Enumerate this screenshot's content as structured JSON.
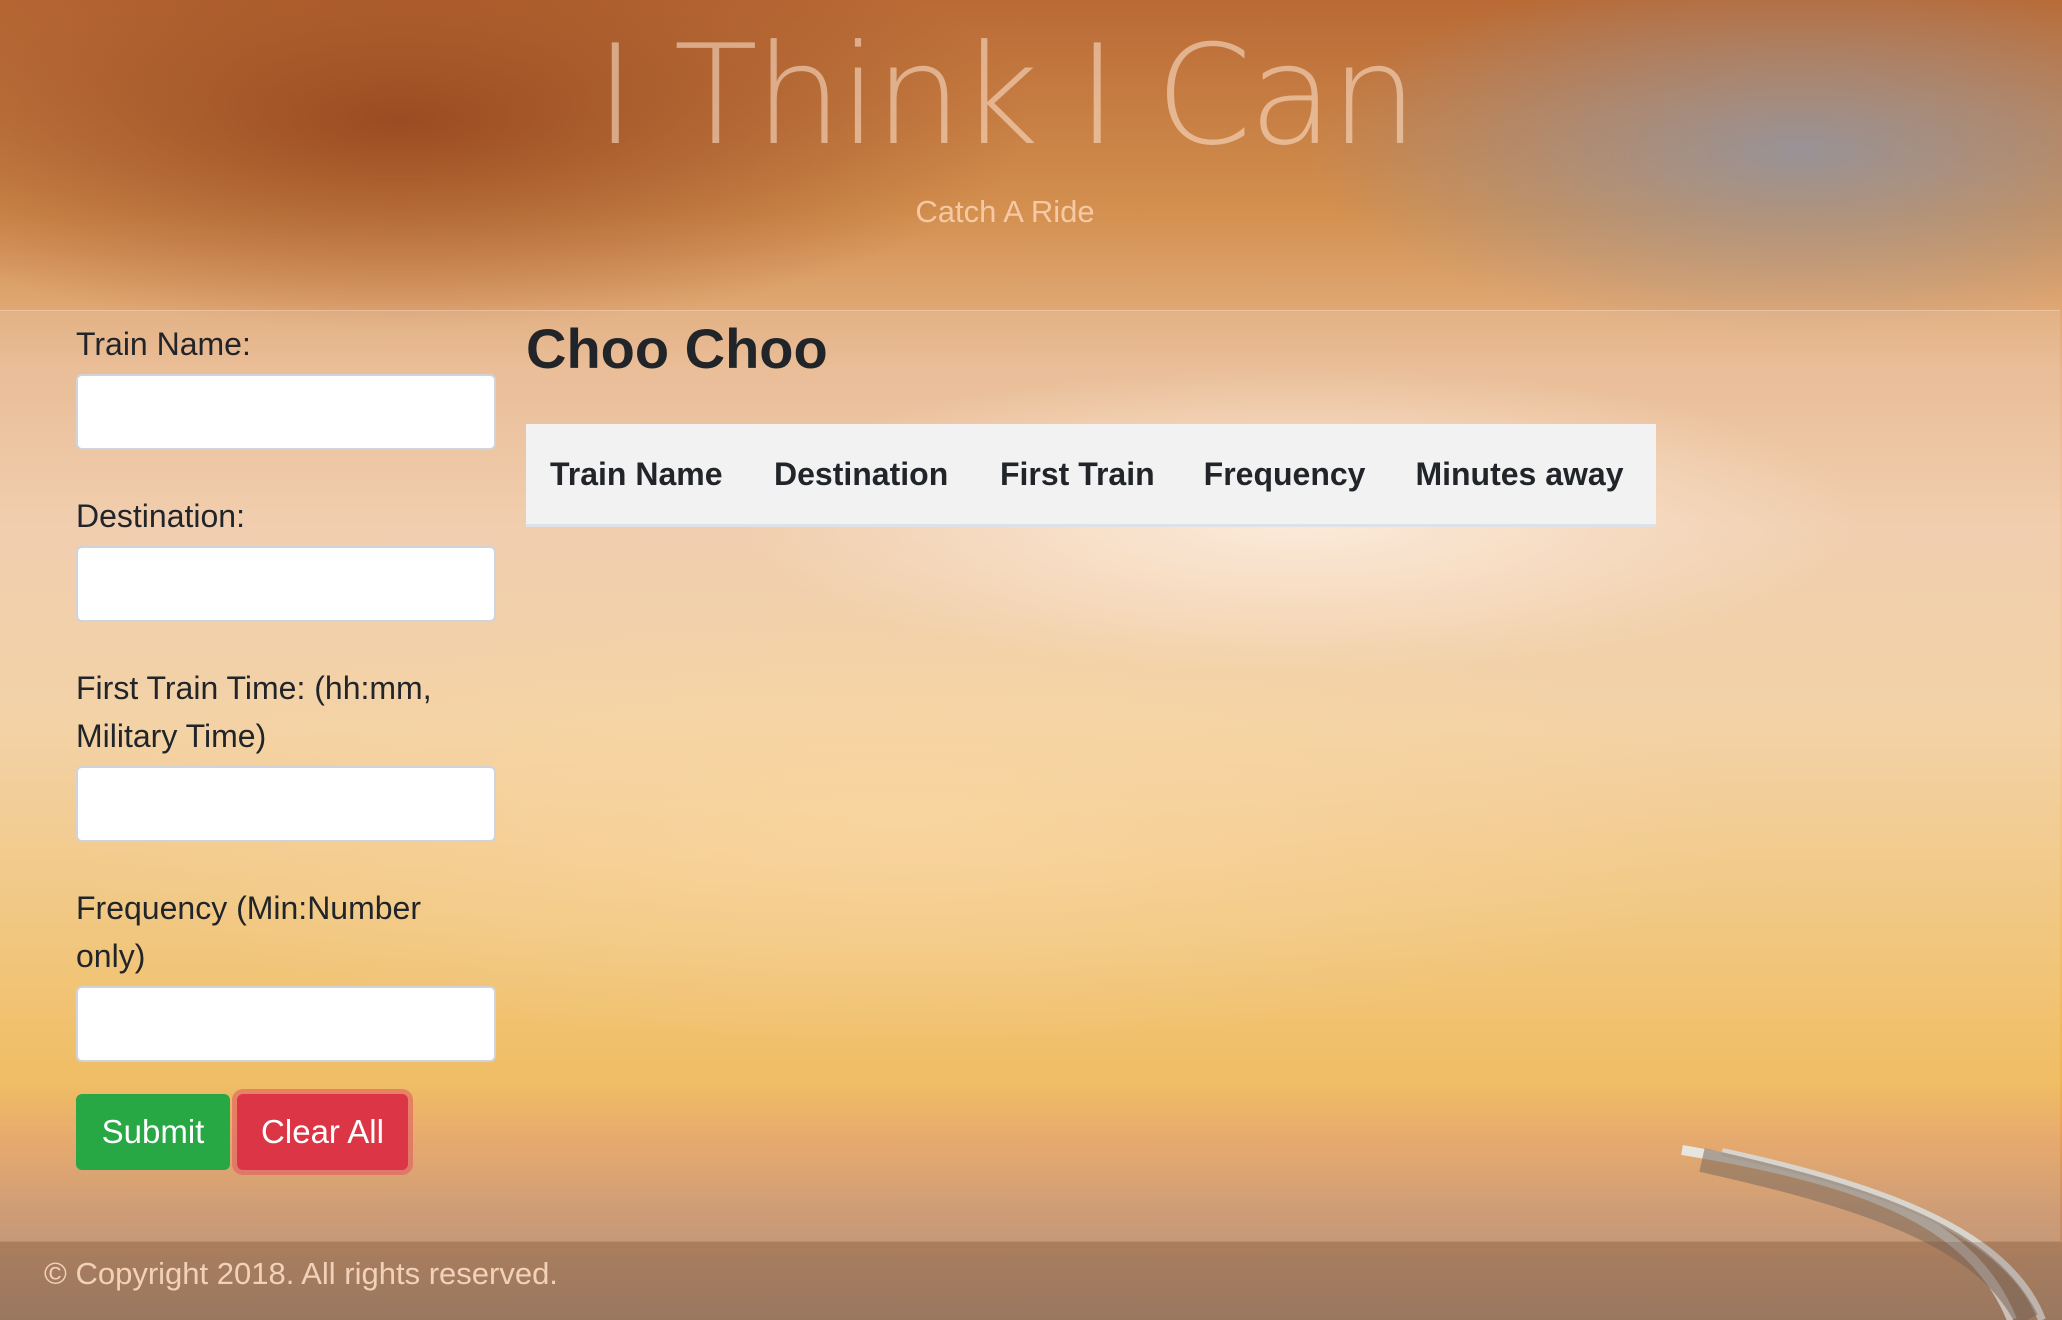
{
  "header": {
    "title": "I Think I Can",
    "subtitle": "Catch A Ride"
  },
  "form": {
    "train_name_label": "Train Name:",
    "train_name_value": "",
    "destination_label": "Destination:",
    "destination_value": "",
    "first_train_label": "First Train Time: (hh:mm, Military Time)",
    "first_train_value": "",
    "frequency_label": "Frequency (Min:Number only)",
    "frequency_value": "",
    "submit_label": "Submit",
    "clear_label": "Clear All"
  },
  "schedule": {
    "title": "Choo Choo",
    "columns": [
      "Train Name",
      "Destination",
      "First Train",
      "Frequency",
      "Minutes away"
    ]
  },
  "footer": {
    "text": "© Copyright 2018. All rights reserved."
  },
  "colors": {
    "submit": "#28a745",
    "clear": "#dc3545"
  }
}
